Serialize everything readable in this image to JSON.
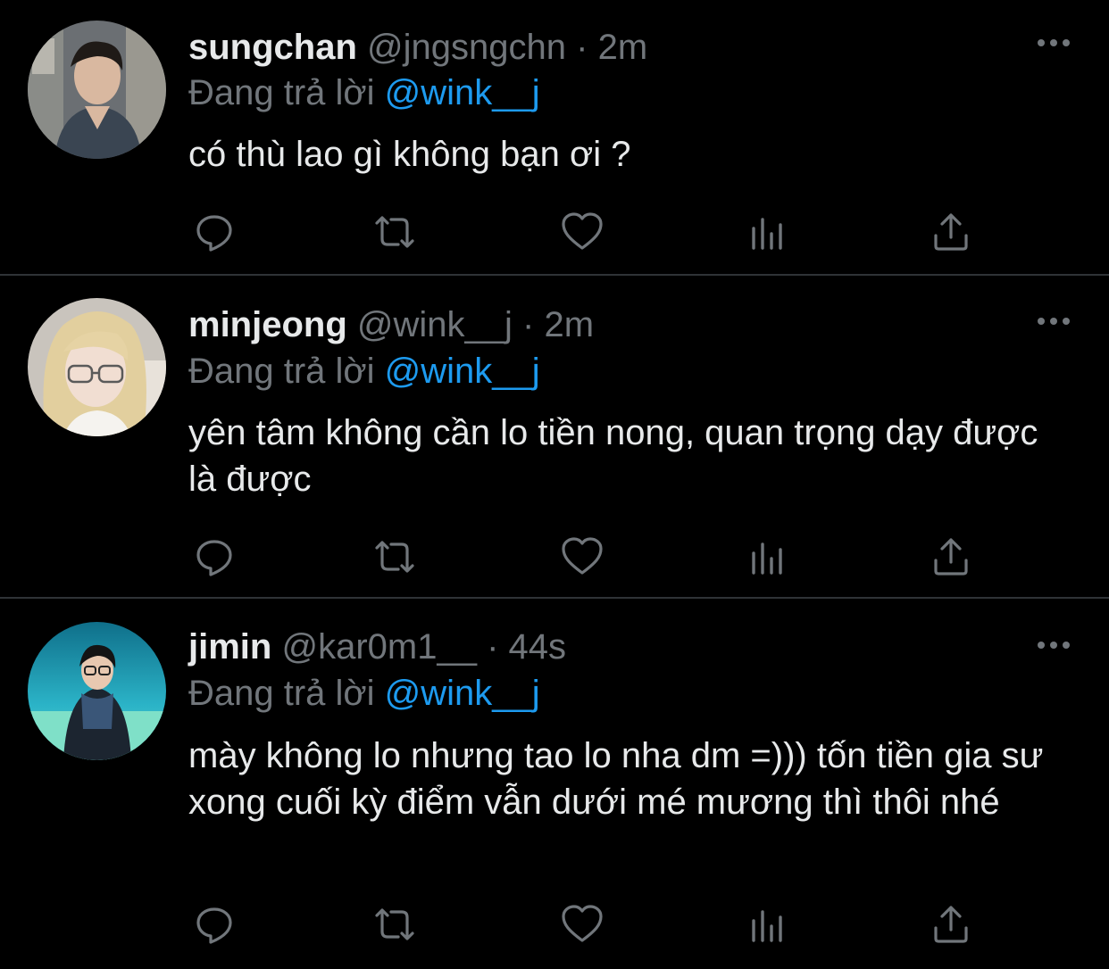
{
  "reply_prefix": "Đang trả lời",
  "colors": {
    "background": "#000000",
    "text": "#e7e9ea",
    "secondary": "#71767b",
    "mention": "#1d9bf0",
    "divider": "#2f3336"
  },
  "icons": [
    "reply-icon",
    "retweet-icon",
    "like-icon",
    "analytics-icon",
    "share-icon",
    "more-icon"
  ],
  "tweets": [
    {
      "name": "sungchan",
      "handle": "@jngsngchn",
      "separator": "·",
      "time": "2m",
      "reply_to": "@wink__j",
      "text": "có thù lao gì không bạn ơi ?"
    },
    {
      "name": "minjeong",
      "handle": "@wink__j",
      "separator": "·",
      "time": "2m",
      "reply_to": "@wink__j",
      "text": "yên tâm không cần lo tiền nong, quan trọng dạy được là được"
    },
    {
      "name": "jimin",
      "handle": "@kar0m1__",
      "separator": "·",
      "time": "44s",
      "reply_to": "@wink__j",
      "text": "mày không lo nhưng tao lo nha dm =))) tốn tiền gia sư xong cuối kỳ điểm vẫn dưới mé mương thì thôi nhé"
    }
  ]
}
